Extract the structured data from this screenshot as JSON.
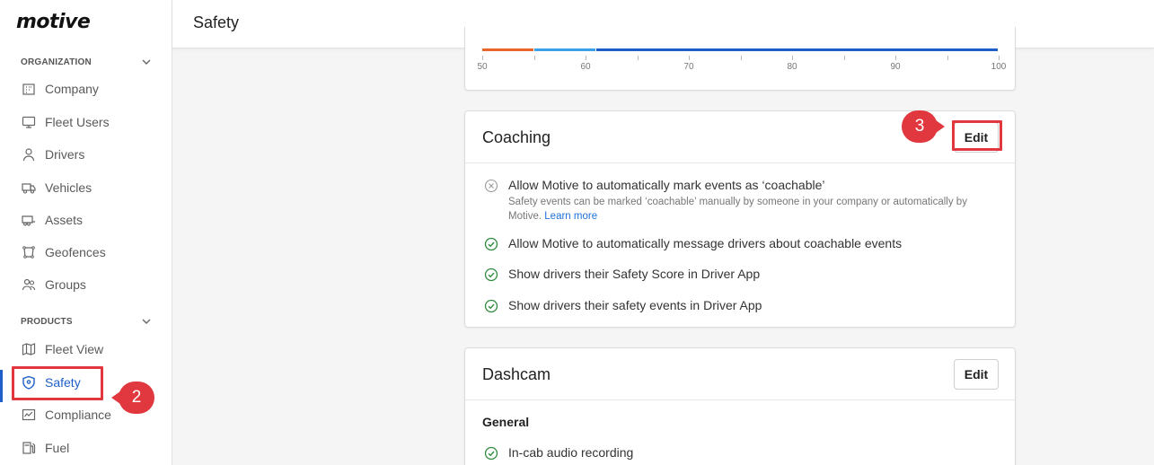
{
  "brand": {
    "logo_text": "motive",
    "accent": "#1e5ec8",
    "highlight": "#e0383e",
    "ok_green": "#2e8b3e"
  },
  "header": {
    "title": "Safety"
  },
  "sidebar": {
    "org_section": "ORGANIZATION",
    "products_section": "PRODUCTS",
    "items": [
      {
        "label": "Company",
        "icon": "building-icon"
      },
      {
        "label": "Fleet Users",
        "icon": "monitor-icon"
      },
      {
        "label": "Drivers",
        "icon": "person-icon"
      },
      {
        "label": "Vehicles",
        "icon": "truck-icon"
      },
      {
        "label": "Assets",
        "icon": "trailer-icon"
      },
      {
        "label": "Geofences",
        "icon": "geofence-icon"
      },
      {
        "label": "Groups",
        "icon": "group-icon"
      },
      {
        "label": "Fleet View",
        "icon": "map-icon"
      },
      {
        "label": "Safety",
        "icon": "shield-icon",
        "active": true
      },
      {
        "label": "Compliance",
        "icon": "compliance-icon"
      },
      {
        "label": "Fuel",
        "icon": "fuel-icon"
      }
    ]
  },
  "score_scale": {
    "ticks": [
      "50",
      "60",
      "70",
      "80",
      "90",
      "100"
    ],
    "segments": [
      {
        "from": 50,
        "to": 55,
        "color": "#e8662c"
      },
      {
        "from": 55,
        "to": 61,
        "color": "#3aa0e8"
      },
      {
        "from": 61,
        "to": 100,
        "color": "#1e5ec8"
      }
    ]
  },
  "coaching": {
    "title": "Coaching",
    "edit_label": "Edit",
    "settings": [
      {
        "label": "Allow Motive to automatically mark events as ‘coachable’",
        "enabled": false,
        "description": "Safety events can be marked ‘coachable’ manually by someone in your company or automatically by Motive.",
        "link": "Learn more"
      },
      {
        "label": "Allow Motive to automatically message drivers about coachable events",
        "enabled": true
      },
      {
        "label": "Show drivers their Safety Score in Driver App",
        "enabled": true
      },
      {
        "label": "Show drivers their safety events in Driver App",
        "enabled": true
      }
    ]
  },
  "dashcam": {
    "title": "Dashcam",
    "edit_label": "Edit",
    "section": "General",
    "settings": [
      {
        "label": "In-cab audio recording",
        "enabled": true
      }
    ]
  },
  "steps": {
    "sidebar": "2",
    "edit": "3"
  }
}
